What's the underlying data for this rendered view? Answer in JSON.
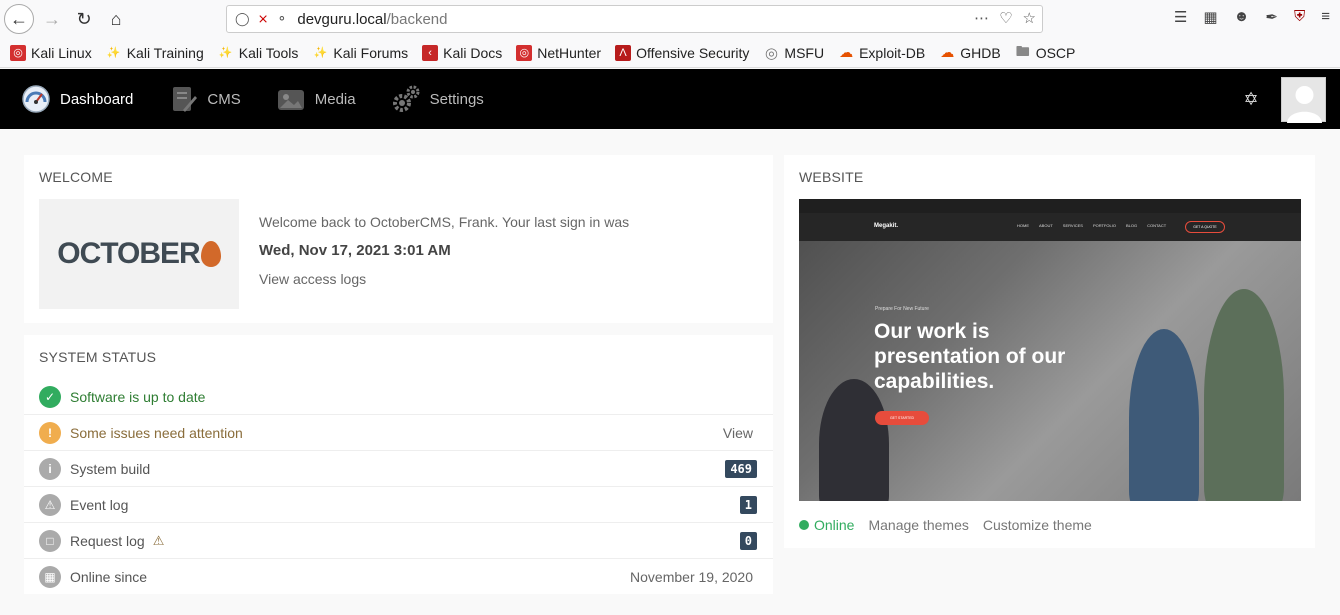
{
  "browser": {
    "url_host": "devguru.local",
    "url_path": "/backend"
  },
  "bookmarks": [
    {
      "label": "Kali Linux",
      "icon": "kali-icon",
      "color": "#d32f2f"
    },
    {
      "label": "Kali Training",
      "icon": "kali-dragon-icon",
      "color": "#222222"
    },
    {
      "label": "Kali Tools",
      "icon": "kali-dragon-icon",
      "color": "#222222"
    },
    {
      "label": "Kali Forums",
      "icon": "kali-dragon-icon",
      "color": "#222222"
    },
    {
      "label": "Kali Docs",
      "icon": "docs-icon",
      "color": "#c62828"
    },
    {
      "label": "NetHunter",
      "icon": "kali-icon",
      "color": "#d32f2f"
    },
    {
      "label": "Offensive Security",
      "icon": "offsec-icon",
      "color": "#b71c1c"
    },
    {
      "label": "MSFU",
      "icon": "globe-icon",
      "color": "#777777"
    },
    {
      "label": "Exploit-DB",
      "icon": "exploitdb-icon",
      "color": "#e65100"
    },
    {
      "label": "GHDB",
      "icon": "exploitdb-icon",
      "color": "#e65100"
    },
    {
      "label": "OSCP",
      "icon": "folder-icon",
      "color": "#888888"
    }
  ],
  "nav": {
    "items": [
      {
        "label": "Dashboard",
        "icon": "dashboard-gauge-icon"
      },
      {
        "label": "CMS",
        "icon": "cms-icon"
      },
      {
        "label": "Media",
        "icon": "media-icon"
      },
      {
        "label": "Settings",
        "icon": "settings-gears-icon"
      }
    ]
  },
  "welcome": {
    "title": "WELCOME",
    "logo_text": "OCTOBER",
    "line1": "Welcome back to OctoberCMS, Frank. Your last sign in was",
    "last_signin": "Wed, Nov 17, 2021 3:01 AM",
    "access_logs_link": "View access logs"
  },
  "system_status": {
    "title": "SYSTEM STATUS",
    "rows": [
      {
        "label": "Software is up to date",
        "icon": "check-circle-icon",
        "color": "#31ac5f",
        "text_color": "#2e7d32",
        "right": ""
      },
      {
        "label": "Some issues need attention",
        "icon": "exclamation-circle-icon",
        "color": "#f0ad4e",
        "text_color": "#8a6d3b",
        "right": "View"
      },
      {
        "label": "System build",
        "icon": "info-circle-icon",
        "color": "#aaaaaa",
        "text_color": "#555555",
        "badge": "469"
      },
      {
        "label": "Event log",
        "icon": "warning-circle-icon",
        "color": "#aaaaaa",
        "text_color": "#555555",
        "badge": "1"
      },
      {
        "label": "Request log",
        "icon": "file-circle-icon",
        "color": "#aaaaaa",
        "text_color": "#555555",
        "badge": "0"
      },
      {
        "label": "Online since",
        "icon": "calendar-circle-icon",
        "color": "#aaaaaa",
        "text_color": "#555555",
        "right": "November 19, 2020"
      }
    ]
  },
  "website": {
    "title": "WEBSITE",
    "preview": {
      "brand": "Megakit.",
      "nav_links": [
        "HOME",
        "ABOUT",
        "SERVICES",
        "PORTFOLIO",
        "BLOG",
        "CONTACT"
      ],
      "cta": "GET A QUOTE",
      "kicker": "Prepare For New Future",
      "headline": "Our work is presentation of our capabilities.",
      "button": "GET STARTED"
    },
    "status": "Online",
    "manage_themes": "Manage themes",
    "customize_theme": "Customize theme"
  }
}
